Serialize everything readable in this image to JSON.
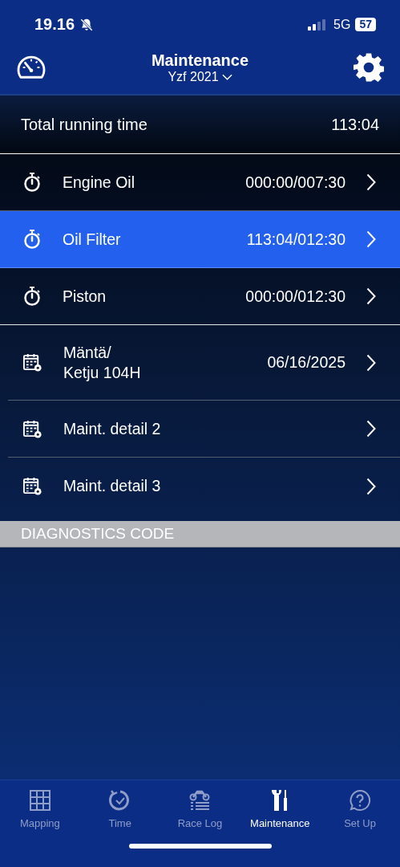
{
  "status_bar": {
    "time": "19.16",
    "network": "5G",
    "battery": "57"
  },
  "header": {
    "title": "Maintenance",
    "subtitle": "Yzf 2021"
  },
  "total_running_time": {
    "label": "Total running time",
    "value": "113:04"
  },
  "timer_items": [
    {
      "label": "Engine Oil",
      "value": "000:00/007:30",
      "selected": false
    },
    {
      "label": "Oil Filter",
      "value": "113:04/012:30",
      "selected": true
    },
    {
      "label": "Piston",
      "value": "000:00/012:30",
      "selected": false
    }
  ],
  "schedule_items": [
    {
      "label": "Mäntä/\nKetju 104H",
      "value": "06/16/2025",
      "selected": false
    },
    {
      "label": "Maint. detail 2",
      "selected": false
    },
    {
      "label": "Maint. detail 3",
      "selected": false
    }
  ],
  "section_header": "DIAGNOSTICS CODE",
  "tab_bar": [
    {
      "label": "Mapping",
      "selected": false
    },
    {
      "label": "Time",
      "selected": false
    },
    {
      "label": "Race Log",
      "selected": false
    },
    {
      "label": "Maintenance",
      "selected": true
    },
    {
      "label": "Set Up",
      "selected": false
    }
  ]
}
